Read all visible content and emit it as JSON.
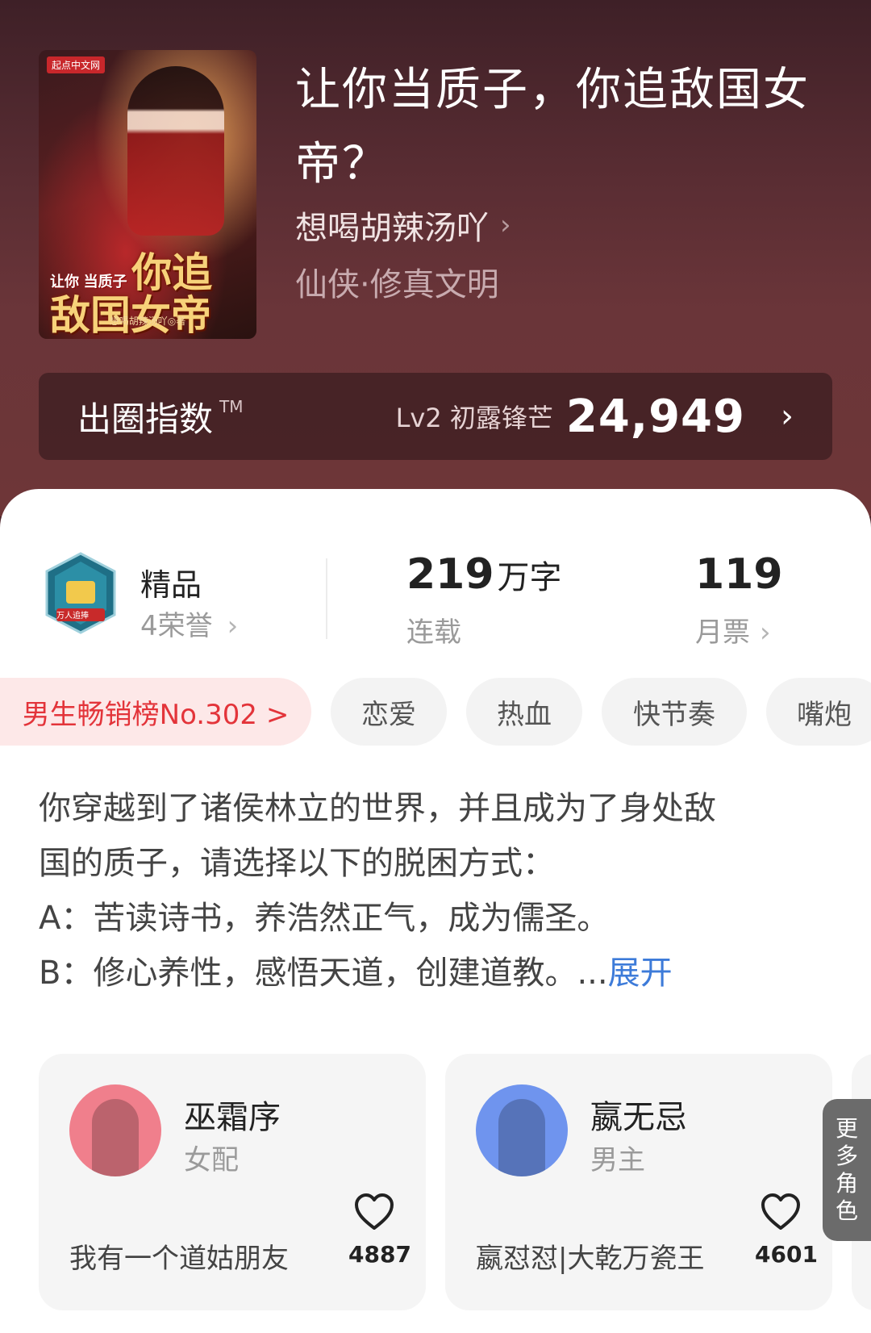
{
  "book": {
    "title": "让你当质子，你追敌国女帝？",
    "author": "想喝胡辣汤吖",
    "genre": "仙侠·修真文明",
    "cover_art": {
      "badge": "起点中文网",
      "line1": "让你",
      "line2": "当质子",
      "line3": "你追",
      "line4": "敌国女帝",
      "author": "想喝胡辣汤吖◎著"
    }
  },
  "index_bar": {
    "label": "出圈指数",
    "tm": "TM",
    "level": "Lv2 初露锋芒",
    "score": "24,949",
    "arrow": "›"
  },
  "stats": {
    "honor": {
      "title": "精品",
      "sub": "4荣誉",
      "chev": "›",
      "icon_label": "万人追捧"
    },
    "words": {
      "num": "219",
      "unit": "万字",
      "sub": "连载"
    },
    "votes": {
      "num": "119",
      "sub": "月票",
      "chev": "›"
    }
  },
  "tags": {
    "rank": "男生畅销榜No.302 >",
    "items": [
      "恋爱",
      "热血",
      "快节奏",
      "嘴炮"
    ]
  },
  "synopsis": {
    "lines": [
      "你穿越到了诸侯林立的世界，并且成为了身处敌",
      "国的质子，请选择以下的脱困方式：",
      "A：苦读诗书，养浩然正气，成为儒圣。",
      "B：修心养性，感悟天道，创建道教。..."
    ],
    "expand": "展开"
  },
  "characters": [
    {
      "name": "巫霜序",
      "role": "女配",
      "quote": "我有一个道姑朋友",
      "likes": "4887",
      "color": "#f07f8c"
    },
    {
      "name": "嬴无忌",
      "role": "男主",
      "quote": "嬴怼怼|大乾万瓷王",
      "likes": "4601",
      "color": "#6f94ee"
    }
  ],
  "more_roles": "更多角色",
  "colors": {
    "accent_red": "#e3343a",
    "link_blue": "#3d7bd9"
  }
}
